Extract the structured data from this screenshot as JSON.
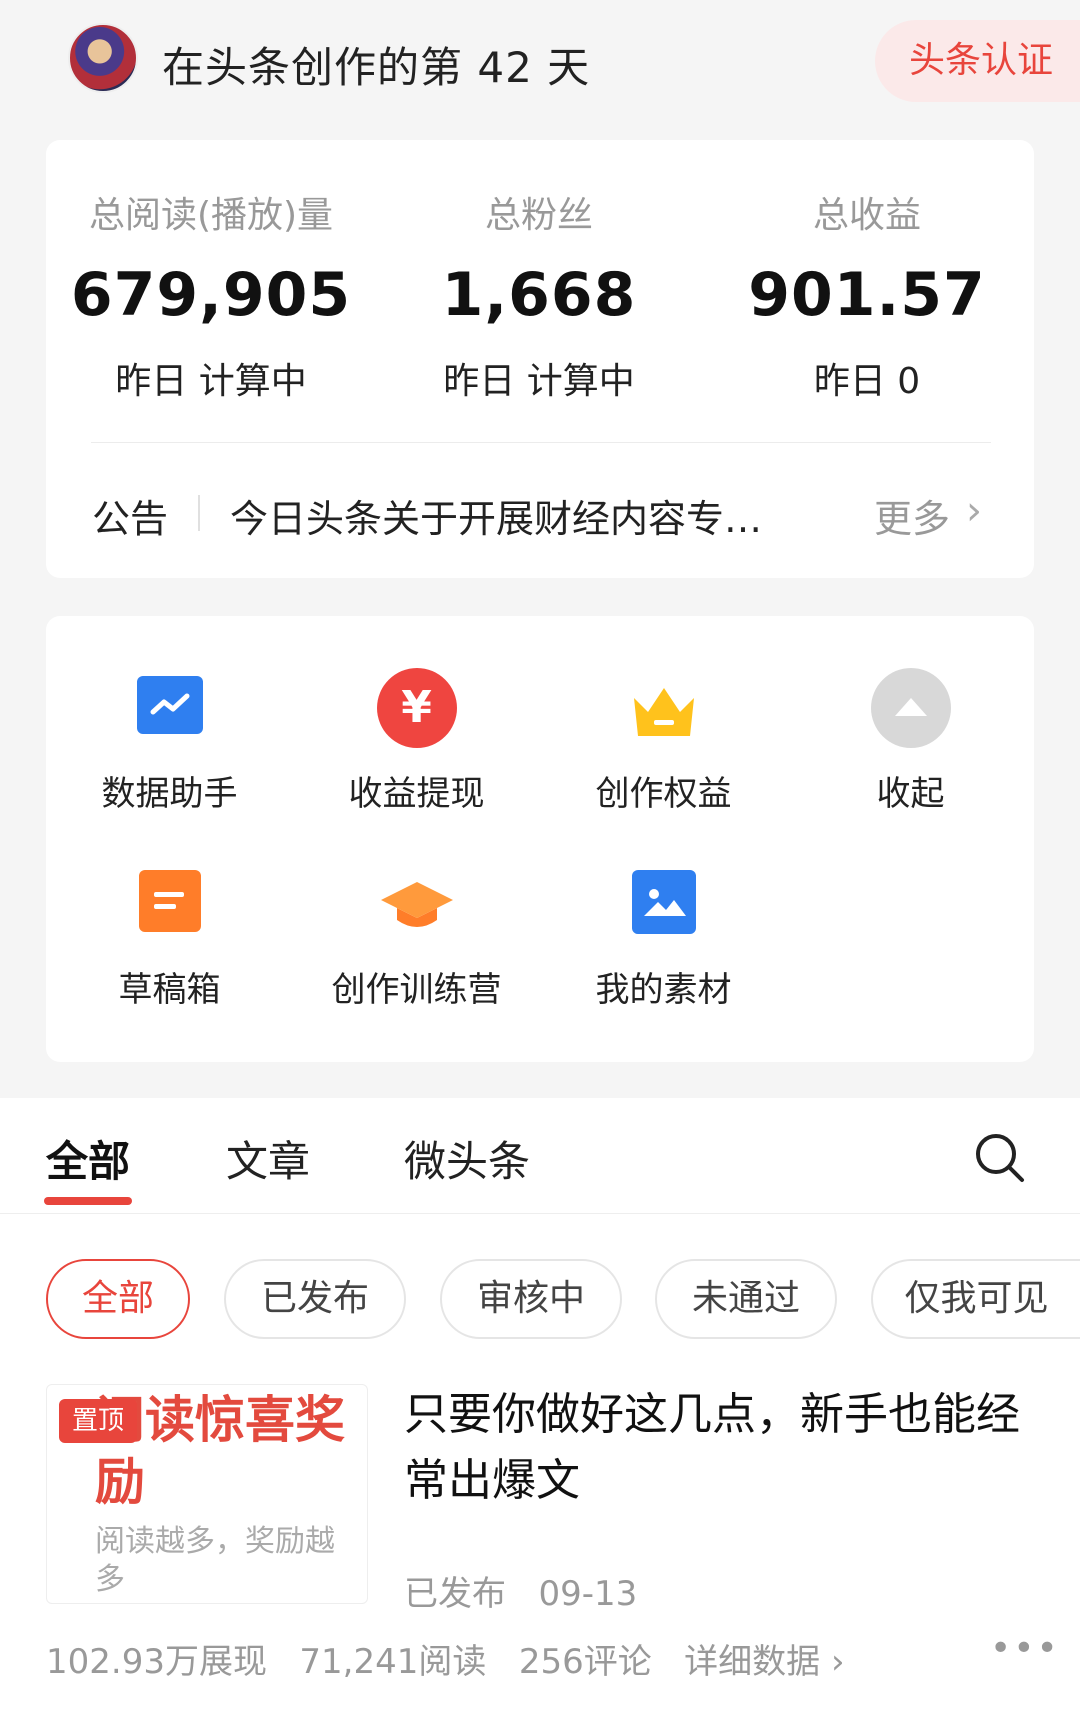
{
  "header": {
    "title": "在头条创作的第 42 天",
    "cert_button": "头条认证"
  },
  "stats": [
    {
      "label": "总阅读(播放)量",
      "value": "679,905",
      "sub": "昨日 计算中"
    },
    {
      "label": "总粉丝",
      "value": "1,668",
      "sub": "昨日 计算中"
    },
    {
      "label": "总收益",
      "value": "901.57",
      "sub": "昨日 0"
    }
  ],
  "notice": {
    "label": "公告",
    "text": "今日头条关于开展财经内容专…",
    "more": "更多"
  },
  "tools": [
    {
      "label": "数据助手",
      "icon": "chart-trend-icon"
    },
    {
      "label": "收益提现",
      "icon": "yen-icon"
    },
    {
      "label": "创作权益",
      "icon": "crown-icon"
    },
    {
      "label": "收起",
      "icon": "collapse-up-icon"
    },
    {
      "label": "草稿箱",
      "icon": "draft-box-icon"
    },
    {
      "label": "创作训练营",
      "icon": "graduation-cap-icon"
    },
    {
      "label": "我的素材",
      "icon": "image-icon"
    }
  ],
  "tabs": [
    "全部",
    "文章",
    "微头条"
  ],
  "filters": [
    "全部",
    "已发布",
    "审核中",
    "未通过",
    "仅我可见"
  ],
  "article": {
    "pin_badge": "置顶",
    "thumb_title": "阅读惊喜奖励",
    "thumb_sub": "阅读越多，奖励越多",
    "title": "只要你做好这几点，新手也能经常出爆文",
    "status": "已发布",
    "date": "09-13",
    "impressions": "102.93万展现",
    "reads": "71,241阅读",
    "comments": "256评论",
    "details": "详细数据"
  },
  "colors": {
    "accent": "#e8453c",
    "blue": "#2f7ff0",
    "orange": "#ff7d29",
    "gold": "#ffc21c"
  }
}
